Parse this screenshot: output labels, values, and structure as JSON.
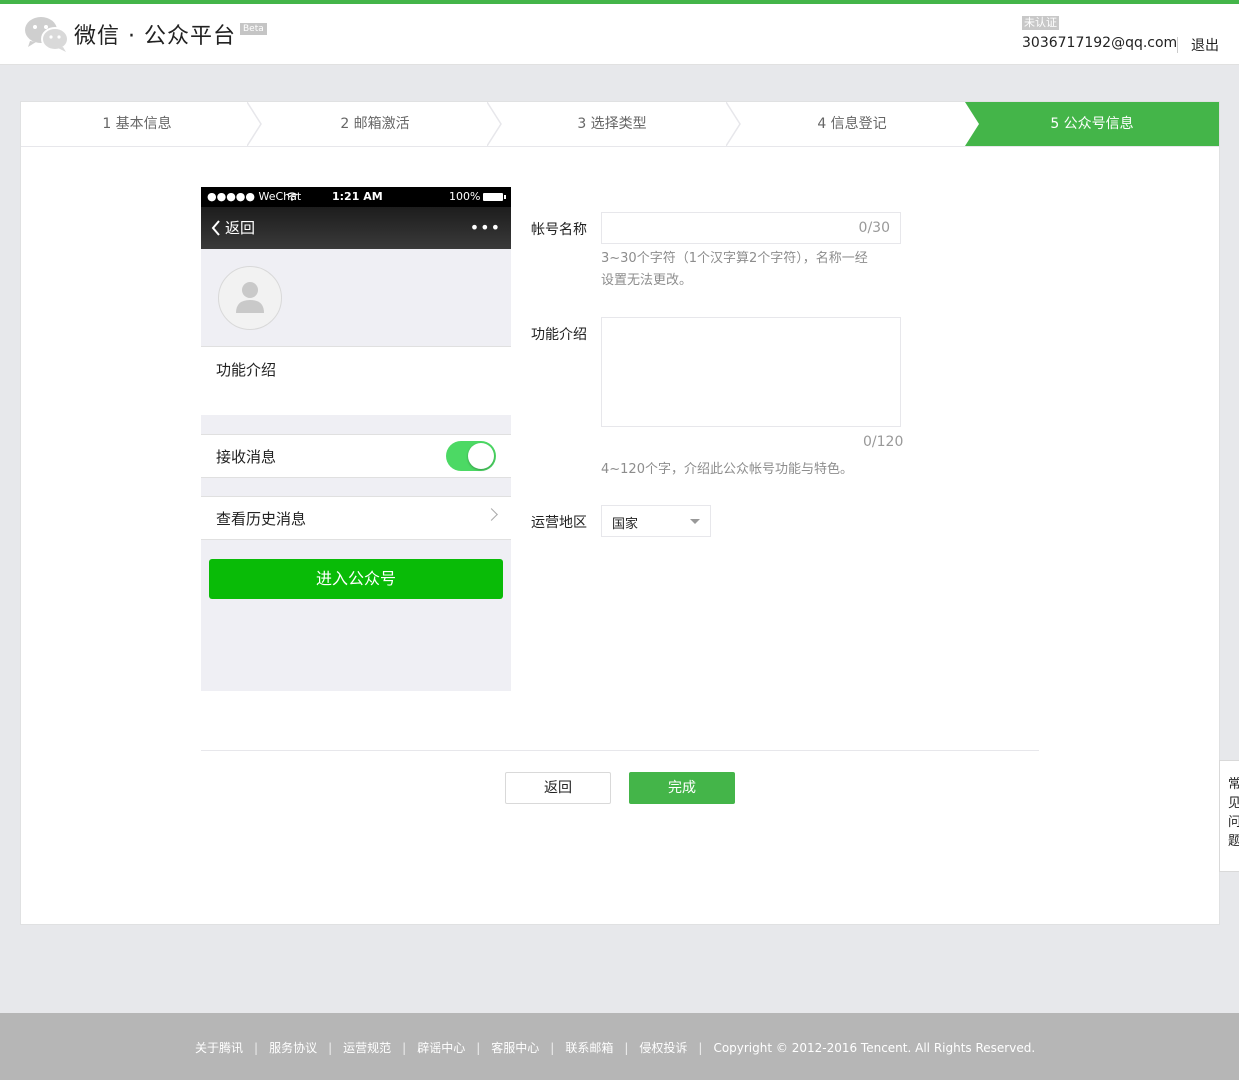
{
  "header": {
    "logo_text": "微信 · 公众平台",
    "beta_badge": "Beta",
    "account_status": "未认证",
    "account_email": "3036717192@qq.com",
    "logout_label": "退出"
  },
  "steps": [
    {
      "label": "1 基本信息",
      "active": false
    },
    {
      "label": "2 邮箱激活",
      "active": false
    },
    {
      "label": "3 选择类型",
      "active": false
    },
    {
      "label": "4 信息登记",
      "active": false
    },
    {
      "label": "5 公众号信息",
      "active": true
    }
  ],
  "phone": {
    "carrier": "●●●●● WeChat",
    "time": "1:21 AM",
    "battery": "100%",
    "back_label": "返回",
    "more_label": "•••",
    "intro_label": "功能介绍",
    "receive_label": "接收消息",
    "receive_enabled": true,
    "history_label": "查看历史消息",
    "enter_button": "进入公众号"
  },
  "form": {
    "name_label": "帐号名称",
    "name_value": "",
    "name_counter": "0/30",
    "name_hint_line1": "3~30个字符（1个汉字算2个字符），名称一经",
    "name_hint_line2": "设置无法更改。",
    "intro_label": "功能介绍",
    "intro_value": "",
    "intro_counter": "0/120",
    "intro_hint": "4~120个字，介绍此公众帐号功能与特色。",
    "region_label": "运营地区",
    "region_value": "国家"
  },
  "actions": {
    "back_label": "返回",
    "done_label": "完成"
  },
  "faq_tab": "常见问题",
  "footer": {
    "links": [
      "关于腾讯",
      "服务协议",
      "运营规范",
      "辟谣中心",
      "客服中心",
      "联系邮箱",
      "侵权投诉"
    ],
    "copyright": "Copyright © 2012-2016 Tencent. All Rights Reserved."
  },
  "colors": {
    "brand_green": "#44b549",
    "enter_button_green": "#09bb07",
    "toggle_green": "#4cd964"
  }
}
